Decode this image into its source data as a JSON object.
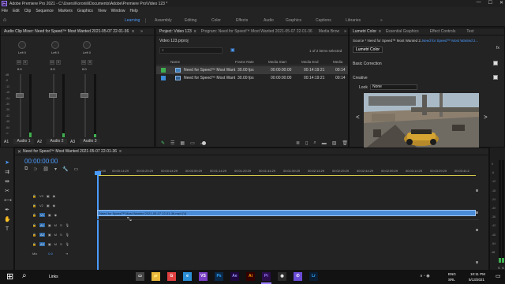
{
  "window": {
    "title": "Adobe Premiere Pro 2021 - C:\\Users\\Koroniii\\Documents\\Adobe\\Premiere Pro\\Video 123 *",
    "logo": "Pr",
    "controls": [
      "—",
      "☐",
      "✕"
    ]
  },
  "menubar": [
    "File",
    "Edit",
    "Clip",
    "Sequence",
    "Markers",
    "Graphics",
    "View",
    "Window",
    "Help"
  ],
  "workspaces": {
    "items": [
      "Learning",
      "Assembly",
      "Editing",
      "Color",
      "Effects",
      "Audio",
      "Graphics",
      "Captions",
      "Libraries"
    ],
    "active": "Learning",
    "more": "»"
  },
  "audio_mixer": {
    "tab": "Audio Clip Mixer: Need for Speed™ Most Wanted 2021-05-07 22-01-36",
    "tab_menu": "≡",
    "more": "»",
    "knob_label": "Left 0",
    "zero_label": "0.0",
    "db_scale": [
      "dB",
      "-6",
      "-12",
      "-18",
      "-24",
      "-30",
      "-36",
      "-42",
      "-48",
      "-54",
      "-∞"
    ],
    "channels": [
      {
        "id": "A1",
        "name": "Audio 1",
        "m": "M",
        "s": "S",
        "level": 0.08
      },
      {
        "id": "A2",
        "name": "Audio 2",
        "m": "M",
        "s": "S",
        "level": 0.06
      },
      {
        "id": "A3",
        "name": "Audio 3",
        "m": "M",
        "s": "S",
        "level": 0.05
      }
    ],
    "transport": [
      "⏮",
      "◀",
      "▶",
      "↻",
      "⏭"
    ]
  },
  "project": {
    "tabs": [
      "Project: Video 123",
      "Program: Need for Speed™ Most Wanted 2021-05-07 22-01-36",
      "Media Brow"
    ],
    "tab_menu": "≡",
    "more": "»",
    "project_file": "Video 123.prproj",
    "items_selected": "1 of 2 items selected",
    "columns": [
      "Name",
      "Frame Rate",
      "Media Start",
      "Media End",
      "Media"
    ],
    "rows": [
      {
        "name": "Need for Speed™ Most Want",
        "fps": "30.00 fps",
        "start": "00:00:00:00",
        "end": "00:14:19:21",
        "media": "00:14",
        "selected": true
      },
      {
        "name": "Need for Speed™ Most Want",
        "fps": "30.00 fps",
        "start": "00:00:00:00",
        "end": "00:14:19:21",
        "media": "00:14",
        "selected": false
      }
    ]
  },
  "lumetri": {
    "tabs": [
      "Lumetri Color",
      "Essential Graphics",
      "Effect Controls",
      "Text"
    ],
    "tab_menu": "≡",
    "source": "Source * Need for Speed™ Most Wanted 2...",
    "target": "Need for Speed™ Most Wanted 2...",
    "chip": "Lumetri Color",
    "basic_correction": "Basic Correction",
    "creative": "Creative",
    "look_label": "Look",
    "look_value": "None",
    "prev_arrow": "<",
    "next_arrow": ">",
    "fx": "fx"
  },
  "timeline": {
    "tab": "Need for Speed™ Most Wanted 2021-05-07 22-01-36",
    "tab_menu": "≡",
    "timecode": "00:00:00:00",
    "ruler": [
      ":00:00",
      "00:00:14:29",
      "00:00:29:29",
      "00:00:44:29",
      "00:00:59:29",
      "00:01:14:29",
      "00:01:29:29",
      "00:01:44:29",
      "00:01:59:29",
      "00:02:14:29",
      "00:02:29:29",
      "00:02:44:29",
      "00:02:59:29",
      "00:03:14:29",
      "00:03:29:29",
      "00:03:44:2"
    ],
    "tracks": [
      {
        "id": "V3",
        "toggle": "V3",
        "type": "video"
      },
      {
        "id": "V2",
        "toggle": "V2",
        "type": "video"
      },
      {
        "id": "V1",
        "toggle": "V1",
        "type": "video",
        "clip": "Need for Speed™ Most Wanted 2021-05-07 22-01-36.mp4 [V]"
      },
      {
        "id": "A1",
        "toggle": "A1",
        "type": "audio",
        "m": "M",
        "s": "S"
      },
      {
        "id": "A2",
        "toggle": "A2",
        "type": "audio",
        "m": "M",
        "s": "S"
      },
      {
        "id": "A3",
        "toggle": "A3",
        "type": "audio",
        "m": "M",
        "s": "S"
      }
    ],
    "master": {
      "label": "Mix",
      "value": "0.0"
    },
    "db_labels": [
      "0",
      "-6",
      "-12",
      "-18",
      "-24",
      "-30",
      "-36",
      "-42",
      "-48",
      "-54",
      "dB"
    ],
    "solo_labels": [
      "S",
      "S"
    ]
  },
  "taskbar": {
    "start": "⊞",
    "search": "⌕",
    "links": "Links",
    "apps": [
      "▭",
      "📁",
      "G",
      "e",
      "VS",
      "Ps",
      "Ae",
      "Ai",
      "Pr",
      "◉",
      "✆",
      "Lr"
    ],
    "tray": "∧ ▫ ◉",
    "lang": [
      "ENG",
      "SRL"
    ],
    "time": "10:11 PM",
    "date": "5/13/2021",
    "accent": "#9a7cff",
    "active_app": "Pr"
  },
  "colors": {
    "accent_blue": "#4b9bff",
    "clip_blue": "#4a8bd6",
    "meter_green": "#3fb04f",
    "playhead": "#4b9bff"
  }
}
